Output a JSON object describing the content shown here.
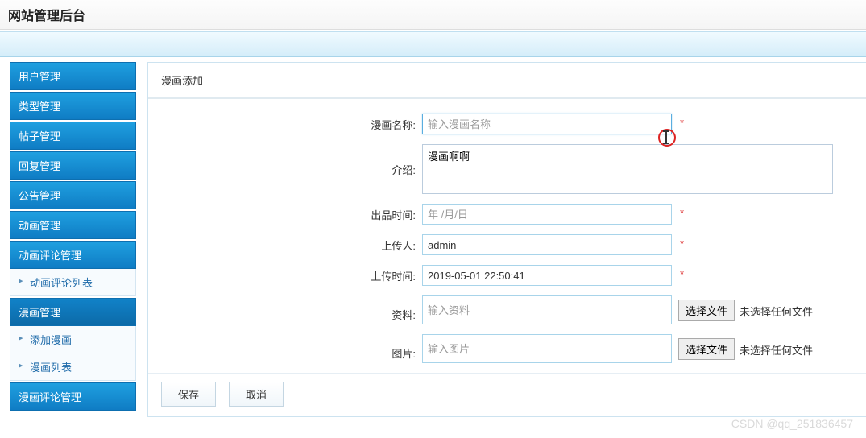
{
  "header": {
    "title": "网站管理后台"
  },
  "sidebar": {
    "items": [
      {
        "label": "用户管理",
        "subs": []
      },
      {
        "label": "类型管理",
        "subs": []
      },
      {
        "label": "帖子管理",
        "subs": []
      },
      {
        "label": "回复管理",
        "subs": []
      },
      {
        "label": "公告管理",
        "subs": []
      },
      {
        "label": "动画管理",
        "subs": []
      },
      {
        "label": "动画评论管理",
        "subs": [
          {
            "label": "动画评论列表"
          }
        ]
      },
      {
        "label": "漫画管理",
        "subs": [
          {
            "label": "添加漫画"
          },
          {
            "label": "漫画列表"
          }
        ],
        "active": true
      },
      {
        "label": "漫画评论管理",
        "subs": []
      }
    ]
  },
  "page": {
    "title": "漫画添加",
    "fields": {
      "name_label": "漫画名称:",
      "name_placeholder": "输入漫画名称",
      "name_value": "",
      "intro_label": "介绍:",
      "intro_value": "漫画啊啊",
      "release_label": "出品时间:",
      "release_placeholder": "年 /月/日",
      "release_value": "",
      "uploader_label": "上传人:",
      "uploader_value": "admin",
      "uploadtime_label": "上传时间:",
      "uploadtime_value": "2019-05-01 22:50:41",
      "material_label": "资料:",
      "material_placeholder": "输入资料",
      "pic_label": "图片:",
      "pic_placeholder": "输入图片",
      "fsel_btn": "选择文件",
      "fsel_none": "未选择任何文件"
    },
    "actions": {
      "save": "保存",
      "cancel": "取消"
    }
  },
  "watermark": "CSDN @qq_251836457"
}
